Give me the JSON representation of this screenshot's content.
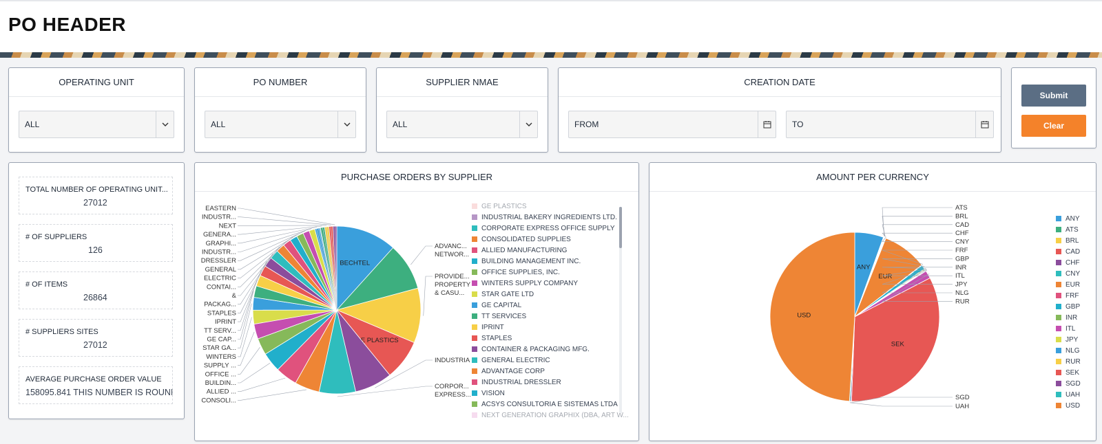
{
  "header": {
    "title": "PO HEADER"
  },
  "filters": {
    "operating_unit": {
      "label": "OPERATING UNIT",
      "value": "ALL"
    },
    "po_number": {
      "label": "PO NUMBER",
      "value": "ALL"
    },
    "supplier_name": {
      "label": "SUPPLIER NMAE",
      "value": "ALL"
    },
    "creation_date": {
      "label": "CREATION DATE",
      "from": "FROM",
      "to": "TO"
    },
    "submit_label": "Submit",
    "clear_label": "Clear"
  },
  "stats": [
    {
      "label": "TOTAL NUMBER OF OPERATING UNIT...",
      "value": "27012"
    },
    {
      "label": "# OF SUPPLIERS",
      "value": "126"
    },
    {
      "label": "# OF ITEMS",
      "value": "26864"
    },
    {
      "label": "# SUPPLIERS SITES",
      "value": "27012"
    },
    {
      "label": "AVERAGE PURCHASE ORDER VALUE",
      "value": "158095.841 THIS NUMBER IS ROUNDED"
    }
  ],
  "colors": {
    "accent_orange": "#f4822a",
    "submit_blue": "#5b6e84",
    "border": "#9aa3b2"
  },
  "chart_data": [
    {
      "type": "pie",
      "title": "PURCHASE ORDERS BY SUPPLIER",
      "slices": [
        {
          "name": "BECHTEL",
          "value": 10.5,
          "color": "#3a9fdc"
        },
        {
          "name": "ADVANC... NETWOR...",
          "value": 8.2,
          "color": "#3daf7f"
        },
        {
          "name": "PROVIDE... PROPERTY & CASU...",
          "value": 9.5,
          "color": "#f7cf47"
        },
        {
          "name": "GE PLASTICS",
          "value": 7.0,
          "color": "#e75754"
        },
        {
          "name": "INDUSTRIAL BAKERY ...",
          "value": 6.5,
          "color": "#8b4d9c"
        },
        {
          "name": "CORPOR... EXPRESS...",
          "value": 6.3,
          "color": "#2fbdbd"
        },
        {
          "name": "CONSOLI...",
          "value": 4.3,
          "color": "#ee8535"
        },
        {
          "name": "ALLIED ...",
          "value": 3.8,
          "color": "#e0527d"
        },
        {
          "name": "BUILDIN...",
          "value": 3.4,
          "color": "#21afcb"
        },
        {
          "name": "OFFICE ...",
          "value": 2.9,
          "color": "#86b95a"
        },
        {
          "name": "SUPPLY ...",
          "value": 2.6,
          "color": "#c54eb0"
        },
        {
          "name": "WINTERS",
          "value": 2.4,
          "color": "#d9dd4b"
        },
        {
          "name": "STAR GA...",
          "value": 2.2,
          "color": "#3a9fdc"
        },
        {
          "name": "GE CAP...",
          "value": 2.0,
          "color": "#3daf7f"
        },
        {
          "name": "TT SERV...",
          "value": 1.9,
          "color": "#f7cf47"
        },
        {
          "name": "IPRINT",
          "value": 1.8,
          "color": "#e75754"
        },
        {
          "name": "STAPLES",
          "value": 1.7,
          "color": "#8b4d9c"
        },
        {
          "name": "PACKAG...",
          "value": 1.6,
          "color": "#2fbdbd"
        },
        {
          "name": "&",
          "value": 1.5,
          "color": "#ee8535"
        },
        {
          "name": "CONTAI...",
          "value": 1.4,
          "color": "#e0527d"
        },
        {
          "name": "ELECTRIC",
          "value": 1.3,
          "color": "#21afcb"
        },
        {
          "name": "GENERAL",
          "value": 1.2,
          "color": "#86b95a"
        },
        {
          "name": "DRESSLER",
          "value": 1.1,
          "color": "#c54eb0"
        },
        {
          "name": "INDUSTR...",
          "value": 1.0,
          "color": "#d9dd4b"
        },
        {
          "name": "GRAPHI...",
          "value": 0.9,
          "color": "#3a9fdc"
        },
        {
          "name": "GENERA...",
          "value": 0.8,
          "color": "#3daf7f"
        },
        {
          "name": "NEXT",
          "value": 0.75,
          "color": "#f7cf47"
        },
        {
          "name": "INDUSTR...",
          "value": 0.7,
          "color": "#e75754"
        },
        {
          "name": "EASTERN",
          "value": 0.65,
          "color": "#8b4d9c"
        }
      ],
      "legend": [
        {
          "name": "GE PLASTICS",
          "color": "#f4b6b5"
        },
        {
          "name": "INDUSTRIAL BAKERY INGREDIENTS LTD.",
          "color": "#b696c6"
        },
        {
          "name": "CORPORATE EXPRESS OFFICE SUPPLY",
          "color": "#2fbdbd"
        },
        {
          "name": "CONSOLIDATED SUPPLIES",
          "color": "#ee8535"
        },
        {
          "name": "ALLIED MANUFACTURING",
          "color": "#e0527d"
        },
        {
          "name": "BUILDING MANAGEMENT INC.",
          "color": "#21afcb"
        },
        {
          "name": "OFFICE SUPPLIES, INC.",
          "color": "#86b95a"
        },
        {
          "name": "WINTERS SUPPLY COMPANY",
          "color": "#c54eb0"
        },
        {
          "name": "STAR GATE LTD",
          "color": "#d9dd4b"
        },
        {
          "name": "GE CAPITAL",
          "color": "#3a9fdc"
        },
        {
          "name": "TT SERVICES",
          "color": "#3daf7f"
        },
        {
          "name": "IPRINT",
          "color": "#f7cf47"
        },
        {
          "name": "STAPLES",
          "color": "#e75754"
        },
        {
          "name": "CONTAINER & PACKAGING MFG.",
          "color": "#8b4d9c"
        },
        {
          "name": "GENERAL ELECTRIC",
          "color": "#2fbdbd"
        },
        {
          "name": "ADVANTAGE CORP",
          "color": "#ee8535"
        },
        {
          "name": "INDUSTRIAL DRESSLER",
          "color": "#e0527d"
        },
        {
          "name": "VISION",
          "color": "#21afcb"
        },
        {
          "name": "ACSYS CONSULTORIA E SISTEMAS LTDA",
          "color": "#86b95a"
        },
        {
          "name": "NEXT GENERATION GRAPHIX (DBA, ART W...",
          "color": "#ecb3dc"
        }
      ]
    },
    {
      "type": "pie",
      "title": "AMOUNT PER CURRENCY",
      "slices": [
        {
          "name": "ANY",
          "value": 5.5,
          "color": "#3a9fdc"
        },
        {
          "name": "ATS",
          "value": 0.1,
          "color": "#3daf7f"
        },
        {
          "name": "BRL",
          "value": 0.1,
          "color": "#f7cf47"
        },
        {
          "name": "CAD",
          "value": 0.1,
          "color": "#e75754"
        },
        {
          "name": "CHF",
          "value": 0.1,
          "color": "#8b4d9c"
        },
        {
          "name": "CNY",
          "value": 0.1,
          "color": "#2fbdbd"
        },
        {
          "name": "EUR",
          "value": 8.5,
          "color": "#ee8535"
        },
        {
          "name": "FRF",
          "value": 0.1,
          "color": "#e0527d"
        },
        {
          "name": "GBP",
          "value": 0.8,
          "color": "#21afcb"
        },
        {
          "name": "INR",
          "value": 0.2,
          "color": "#86b95a"
        },
        {
          "name": "ITL",
          "value": 0.1,
          "color": "#c54eb0"
        },
        {
          "name": "JPY",
          "value": 0.1,
          "color": "#d9dd4b"
        },
        {
          "name": "NLG",
          "value": 0.1,
          "color": "#3a9fdc"
        },
        {
          "name": "RUR",
          "value": 1.5,
          "color": "#c54eb0"
        },
        {
          "name": "SEK",
          "value": 33.2,
          "color": "#e75754"
        },
        {
          "name": "SGD",
          "value": 0.2,
          "color": "#8b4d9c"
        },
        {
          "name": "UAH",
          "value": 0.2,
          "color": "#2fbdbd"
        },
        {
          "name": "USD",
          "value": 49.0,
          "color": "#ee8535"
        }
      ],
      "legend": [
        {
          "name": "ANY",
          "color": "#3a9fdc"
        },
        {
          "name": "ATS",
          "color": "#3daf7f"
        },
        {
          "name": "BRL",
          "color": "#f7cf47"
        },
        {
          "name": "CAD",
          "color": "#e75754"
        },
        {
          "name": "CHF",
          "color": "#8b4d9c"
        },
        {
          "name": "CNY",
          "color": "#2fbdbd"
        },
        {
          "name": "EUR",
          "color": "#ee8535"
        },
        {
          "name": "FRF",
          "color": "#e0527d"
        },
        {
          "name": "GBP",
          "color": "#21afcb"
        },
        {
          "name": "INR",
          "color": "#86b95a"
        },
        {
          "name": "ITL",
          "color": "#c54eb0"
        },
        {
          "name": "JPY",
          "color": "#d9dd4b"
        },
        {
          "name": "NLG",
          "color": "#3a9fdc"
        },
        {
          "name": "RUR",
          "color": "#f7cf47"
        },
        {
          "name": "SEK",
          "color": "#e75754"
        },
        {
          "name": "SGD",
          "color": "#8b4d9c"
        },
        {
          "name": "UAH",
          "color": "#2fbdbd"
        },
        {
          "name": "USD",
          "color": "#ee8535"
        }
      ]
    }
  ]
}
